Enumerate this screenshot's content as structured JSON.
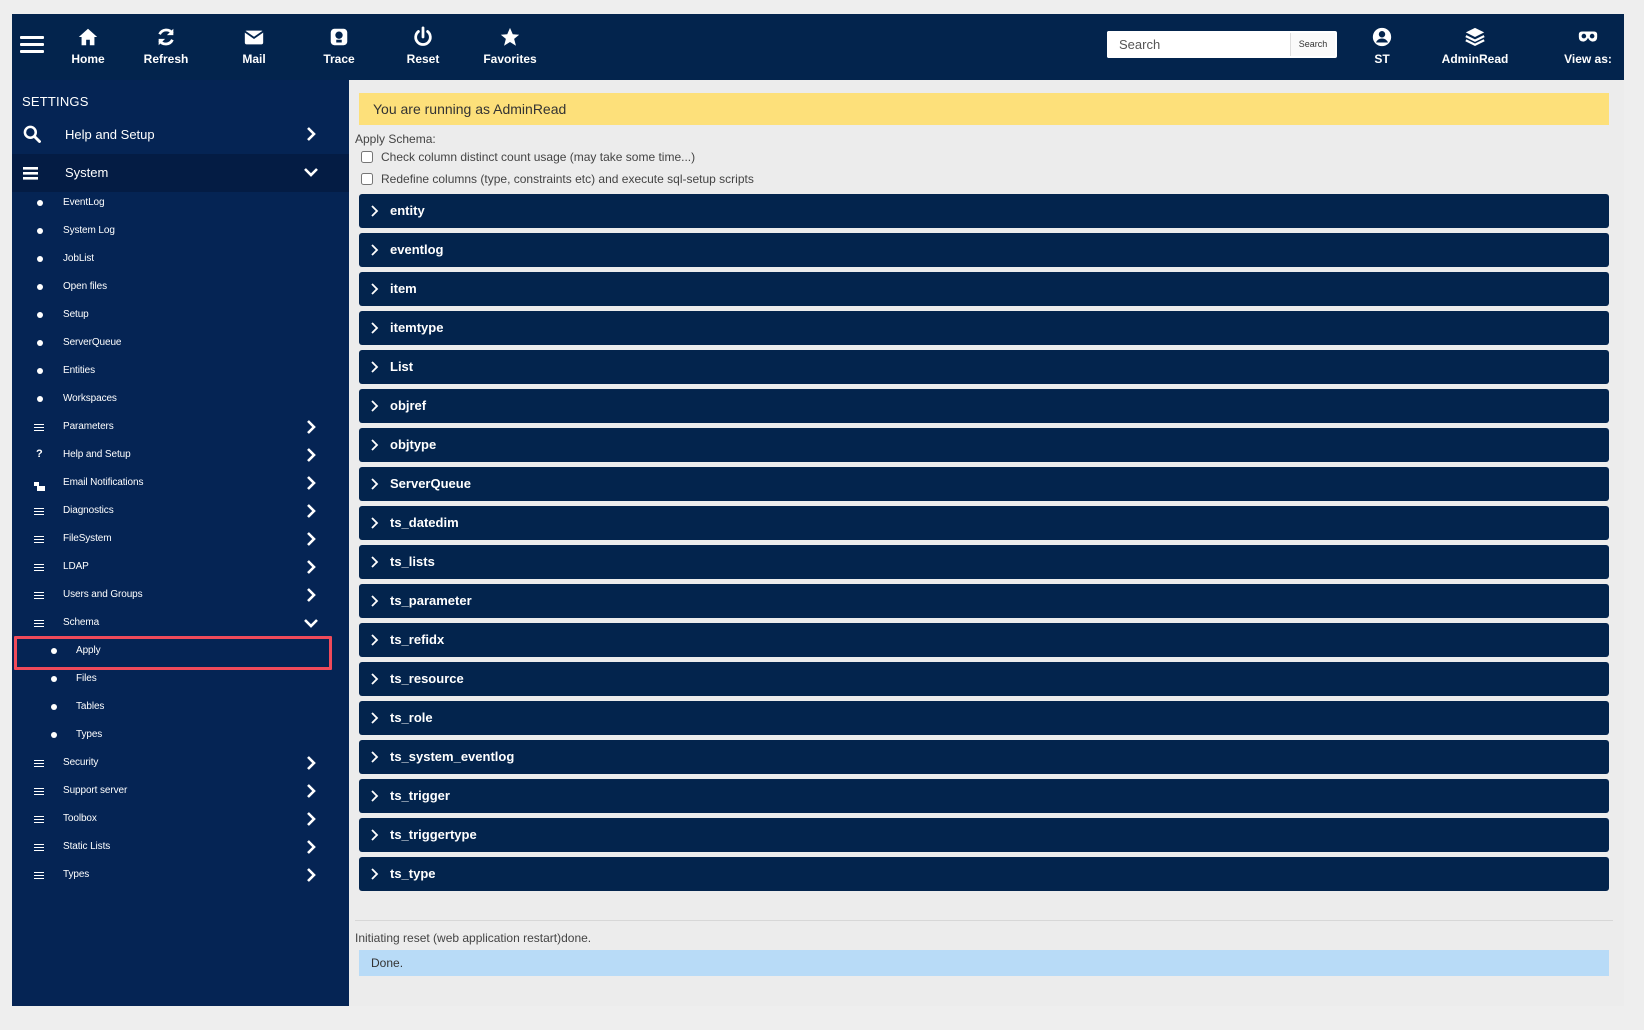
{
  "topbar": {
    "menu_icon": "hamburger-icon",
    "nav": [
      {
        "label": "Home",
        "icon": "home-icon"
      },
      {
        "label": "Refresh",
        "icon": "refresh-icon"
      },
      {
        "label": "Mail",
        "icon": "mail-icon"
      },
      {
        "label": "Trace",
        "icon": "trace-icon"
      },
      {
        "label": "Reset",
        "icon": "power-icon"
      },
      {
        "label": "Favorites",
        "icon": "star-icon"
      }
    ],
    "search": {
      "placeholder": "Search",
      "value": "",
      "button_label": "Search"
    },
    "right": [
      {
        "label": "ST",
        "icon": "user-icon"
      },
      {
        "label": "AdminRead",
        "icon": "layers-icon"
      },
      {
        "label": "View as:",
        "icon": "mask-icon"
      }
    ]
  },
  "sidebar": {
    "title": "SETTINGS",
    "help_setup": "Help and Setup",
    "system": "System",
    "items": [
      {
        "label": "EventLog"
      },
      {
        "label": "System Log"
      },
      {
        "label": "JobList"
      },
      {
        "label": "Open files"
      },
      {
        "label": "Setup"
      },
      {
        "label": "ServerQueue"
      },
      {
        "label": "Entities"
      },
      {
        "label": "Workspaces"
      },
      {
        "label": "Parameters"
      },
      {
        "label": "Help and Setup"
      },
      {
        "label": "Email Notifications"
      },
      {
        "label": "Diagnostics"
      },
      {
        "label": "FileSystem"
      },
      {
        "label": "LDAP"
      },
      {
        "label": "Users and Groups"
      },
      {
        "label": "Schema"
      },
      {
        "label": "Apply"
      },
      {
        "label": "Files"
      },
      {
        "label": "Tables"
      },
      {
        "label": "Types"
      },
      {
        "label": "Security"
      },
      {
        "label": "Support server"
      },
      {
        "label": "Toolbox"
      },
      {
        "label": "Static Lists"
      },
      {
        "label": "Types"
      }
    ]
  },
  "main": {
    "banner": "You are running as AdminRead",
    "apply_label": "Apply Schema:",
    "option1": "Check column distinct count usage (may take some time...)",
    "option2": "Redefine columns (type, constraints etc) and execute sql-setup scripts",
    "tables": [
      "entity",
      "eventlog",
      "item",
      "itemtype",
      "List",
      "objref",
      "objtype",
      "ServerQueue",
      "ts_datedim",
      "ts_lists",
      "ts_parameter",
      "ts_refidx",
      "ts_resource",
      "ts_role",
      "ts_system_eventlog",
      "ts_trigger",
      "ts_triggertype",
      "ts_type"
    ],
    "status_text": "Initiating reset (web application restart)done.",
    "done_text": "Done."
  },
  "colors": {
    "navy": "#03244d",
    "banner_yellow": "#fde07a",
    "done_blue": "#b8dbf7",
    "highlight_red": "#f04a5a"
  }
}
